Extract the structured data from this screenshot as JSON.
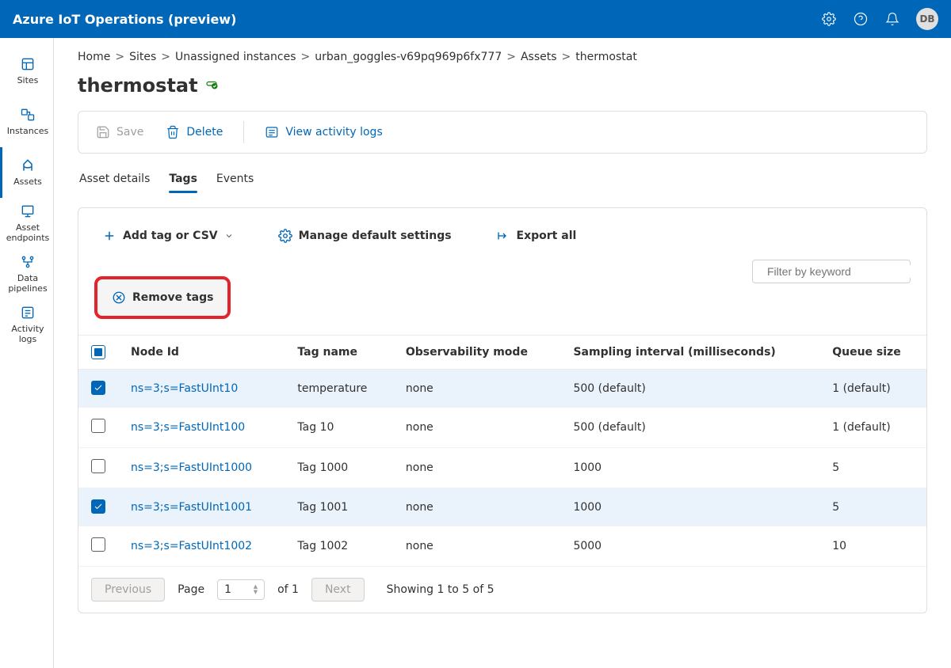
{
  "topbar": {
    "title": "Azure IoT Operations (preview)",
    "avatar": "DB"
  },
  "sidebar": {
    "items": [
      {
        "label": "Sites"
      },
      {
        "label": "Instances"
      },
      {
        "label": "Assets"
      },
      {
        "label": "Asset endpoints"
      },
      {
        "label": "Data pipelines"
      },
      {
        "label": "Activity logs"
      }
    ]
  },
  "breadcrumb": {
    "items": [
      "Home",
      "Sites",
      "Unassigned instances",
      "urban_goggles-v69pq969p6fx777",
      "Assets",
      "thermostat"
    ]
  },
  "page": {
    "title": "thermostat"
  },
  "action_bar": {
    "save": "Save",
    "delete": "Delete",
    "view_logs": "View activity logs"
  },
  "tabs": {
    "items": [
      "Asset details",
      "Tags",
      "Events"
    ],
    "active_index": 1
  },
  "tag_toolbar": {
    "add": "Add tag or CSV",
    "manage": "Manage default settings",
    "export": "Export all",
    "remove": "Remove tags",
    "filter_placeholder": "Filter by keyword"
  },
  "table": {
    "columns": [
      "Node Id",
      "Tag name",
      "Observability mode",
      "Sampling interval (milliseconds)",
      "Queue size"
    ],
    "rows": [
      {
        "checked": true,
        "node_id": "ns=3;s=FastUInt10",
        "tag_name": "temperature",
        "obs": "none",
        "sampling": "500 (default)",
        "queue": "1 (default)"
      },
      {
        "checked": false,
        "node_id": "ns=3;s=FastUInt100",
        "tag_name": "Tag 10",
        "obs": "none",
        "sampling": "500 (default)",
        "queue": "1 (default)"
      },
      {
        "checked": false,
        "node_id": "ns=3;s=FastUInt1000",
        "tag_name": "Tag 1000",
        "obs": "none",
        "sampling": "1000",
        "queue": "5"
      },
      {
        "checked": true,
        "node_id": "ns=3;s=FastUInt1001",
        "tag_name": "Tag 1001",
        "obs": "none",
        "sampling": "1000",
        "queue": "5"
      },
      {
        "checked": false,
        "node_id": "ns=3;s=FastUInt1002",
        "tag_name": "Tag 1002",
        "obs": "none",
        "sampling": "5000",
        "queue": "10"
      }
    ]
  },
  "pagination": {
    "previous": "Previous",
    "page_label": "Page",
    "page_value": "1",
    "of_label": "of 1",
    "next": "Next",
    "showing": "Showing 1 to 5 of 5"
  }
}
